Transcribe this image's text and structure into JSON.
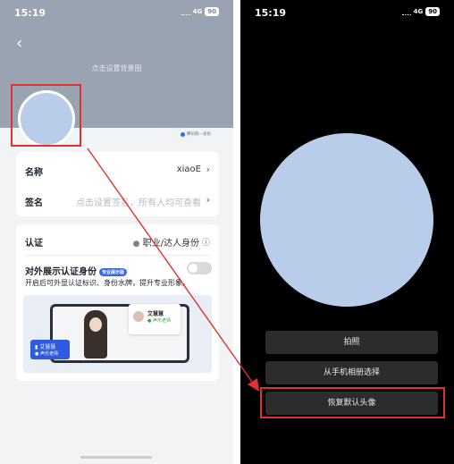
{
  "left_screen": {
    "status": {
      "time": "15:19",
      "network": "4G",
      "battery": "90"
    },
    "banner_hint": "点击设置背景图",
    "badge_text": "腾讯统一身份",
    "profile": [
      {
        "label": "名称",
        "value": "xiaoE"
      },
      {
        "label": "签名",
        "value": "点击设置签名，所有人均可查看"
      }
    ],
    "certification": {
      "label": "认证",
      "value": "职业/达人身份",
      "show_label": "对外展示认证身份",
      "tag": "专业展示版",
      "desc": "开启后可外显认证标识、身份水牌，提升专业形象。",
      "preview": {
        "name": "艾慧慧",
        "role": "声乐老师"
      }
    }
  },
  "right_screen": {
    "status": {
      "time": "15:19",
      "network": "4G",
      "battery": "90"
    },
    "actions": [
      "拍照",
      "从手机相册选择",
      "恢复默认头像"
    ]
  },
  "colors": {
    "highlight": "#e03131",
    "avatar": "#b9ccea",
    "accent": "#3a67e8"
  }
}
